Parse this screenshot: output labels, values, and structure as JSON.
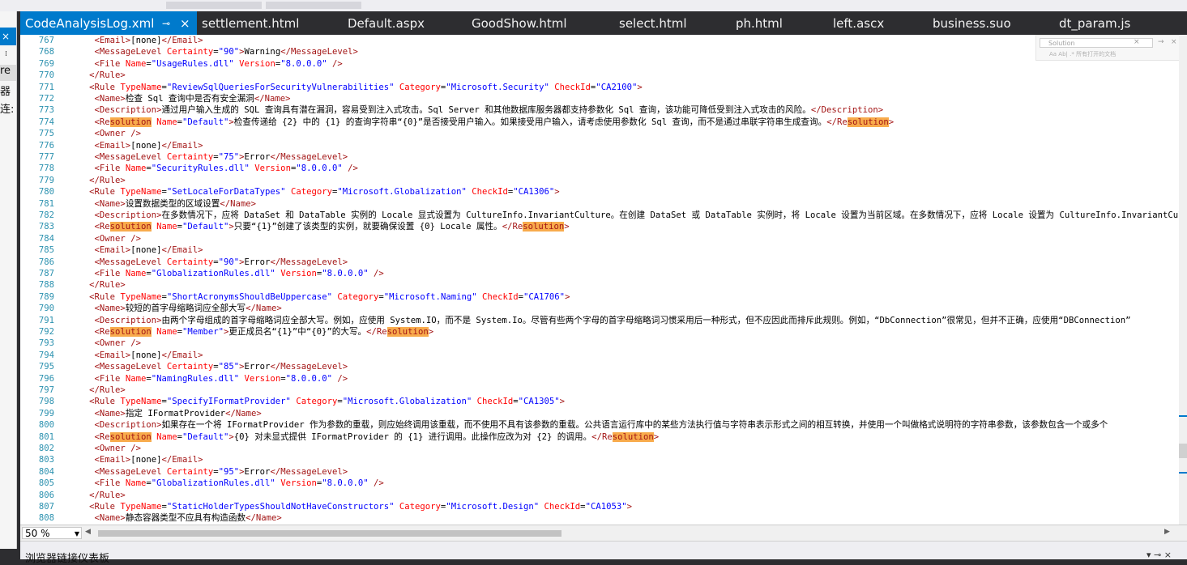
{
  "left_panel": {
    "close_glyph": "×",
    "dots": "⁞",
    "text1": "re",
    "text2": "器",
    "text3": "连:"
  },
  "tabs": [
    {
      "label": "CodeAnalysisLog.xml",
      "active": true,
      "pin": "⊸",
      "close": "×"
    },
    {
      "label": "settlement.html"
    },
    {
      "label": "Default.aspx"
    },
    {
      "label": "GoodShow.html"
    },
    {
      "label": "select.html"
    },
    {
      "label": "ph.html"
    },
    {
      "label": "left.ascx"
    },
    {
      "label": "business.suo"
    },
    {
      "label": "dt_param.js"
    }
  ],
  "search": {
    "placeholder": "Solution",
    "clear_glyph": "×",
    "prev_glyph": "→",
    "close_glyph": "×",
    "options": "Aa  Ab|  .*    所有打开的文档"
  },
  "code_lines": [
    {
      "n": "767",
      "t": "    <Email>[none]</Email>"
    },
    {
      "n": "768",
      "t": "    <MessageLevel Certainty=\"90\">Warning</MessageLevel>"
    },
    {
      "n": "769",
      "t": "    <File Name=\"UsageRules.dll\" Version=\"8.0.0.0\" />"
    },
    {
      "n": "770",
      "t": "   </Rule>"
    },
    {
      "n": "771",
      "t": "   <Rule TypeName=\"ReviewSqlQueriesForSecurityVulnerabilities\" Category=\"Microsoft.Security\" CheckId=\"CA2100\">"
    },
    {
      "n": "772",
      "t": "    <Name>检查 Sql 查询中是否有安全漏洞</Name>"
    },
    {
      "n": "773",
      "t": "    <Description>通过用户输入生成的 SQL 查询具有潜在漏洞，容易受到注入式攻击。Sql Server 和其他数据库服务器都支持参数化 Sql 查询，该功能可降低受到注入式攻击的风险。</Description>"
    },
    {
      "n": "774",
      "t": "    <Resolution Name=\"Default\">检查传递给 {2} 中的 {1} 的查询字符串“{0}”是否接受用户输入。如果接受用户输入，请考虑使用参数化 Sql 查询，而不是通过串联字符串生成查询。</Resolution>"
    },
    {
      "n": "775",
      "t": "    <Owner />"
    },
    {
      "n": "776",
      "t": "    <Email>[none]</Email>"
    },
    {
      "n": "777",
      "t": "    <MessageLevel Certainty=\"75\">Error</MessageLevel>"
    },
    {
      "n": "778",
      "t": "    <File Name=\"SecurityRules.dll\" Version=\"8.0.0.0\" />"
    },
    {
      "n": "779",
      "t": "   </Rule>"
    },
    {
      "n": "780",
      "t": "   <Rule TypeName=\"SetLocaleForDataTypes\" Category=\"Microsoft.Globalization\" CheckId=\"CA1306\">"
    },
    {
      "n": "781",
      "t": "    <Name>设置数据类型的区域设置</Name>"
    },
    {
      "n": "782",
      "t": "    <Description>在多数情况下，应将 DataSet 和 DataTable 实例的 Locale 显式设置为 CultureInfo.InvariantCulture。在创建 DataSet 或 DataTable 实例时，将 Locale 设置为当前区域。在多数情况下，应将 Locale 设置为 CultureInfo.InvariantCulture"
    },
    {
      "n": "783",
      "t": "    <Resolution Name=\"Default\">只要“{1}”创建了该类型的实例，就要确保设置 {0} Locale 属性。</Resolution>"
    },
    {
      "n": "784",
      "t": "    <Owner />"
    },
    {
      "n": "785",
      "t": "    <Email>[none]</Email>"
    },
    {
      "n": "786",
      "t": "    <MessageLevel Certainty=\"90\">Error</MessageLevel>"
    },
    {
      "n": "787",
      "t": "    <File Name=\"GlobalizationRules.dll\" Version=\"8.0.0.0\" />"
    },
    {
      "n": "788",
      "t": "   </Rule>"
    },
    {
      "n": "789",
      "t": "   <Rule TypeName=\"ShortAcronymsShouldBeUppercase\" Category=\"Microsoft.Naming\" CheckId=\"CA1706\">"
    },
    {
      "n": "790",
      "t": "    <Name>较短的首字母缩略词应全部大写</Name>"
    },
    {
      "n": "791",
      "t": "    <Description>由两个字母组成的首字母缩略词应全部大写。例如，应使用 System.IO，而不是 System.Io。尽管有些两个字母的首字母缩略词习惯采用后一种形式，但不应因此而排斥此规则。例如，“DbConnection”很常见，但并不正确，应使用“DBConnection”"
    },
    {
      "n": "792",
      "t": "    <Resolution Name=\"Member\">更正成员名“{1}”中“{0}”的大写。</Resolution>"
    },
    {
      "n": "793",
      "t": "    <Owner />"
    },
    {
      "n": "794",
      "t": "    <Email>[none]</Email>"
    },
    {
      "n": "795",
      "t": "    <MessageLevel Certainty=\"85\">Error</MessageLevel>"
    },
    {
      "n": "796",
      "t": "    <File Name=\"NamingRules.dll\" Version=\"8.0.0.0\" />"
    },
    {
      "n": "797",
      "t": "   </Rule>"
    },
    {
      "n": "798",
      "t": "   <Rule TypeName=\"SpecifyIFormatProvider\" Category=\"Microsoft.Globalization\" CheckId=\"CA1305\">"
    },
    {
      "n": "799",
      "t": "    <Name>指定 IFormatProvider</Name>"
    },
    {
      "n": "800",
      "t": "    <Description>如果存在一个将 IFormatProvider 作为参数的重载，则应始终调用该重载，而不使用不具有该参数的重载。公共语言运行库中的某些方法执行值与字符串表示形式之间的相互转换，并使用一个叫做格式说明符的字符串参数，该参数包含一个或多个"
    },
    {
      "n": "801",
      "t": "    <Resolution Name=\"Default\">{0} 对未显式提供 IFormatProvider 的 {1} 进行调用。此操作应改为对 {2} 的调用。</Resolution>"
    },
    {
      "n": "802",
      "t": "    <Owner />"
    },
    {
      "n": "803",
      "t": "    <Email>[none]</Email>"
    },
    {
      "n": "804",
      "t": "    <MessageLevel Certainty=\"95\">Error</MessageLevel>"
    },
    {
      "n": "805",
      "t": "    <File Name=\"GlobalizationRules.dll\" Version=\"8.0.0.0\" />"
    },
    {
      "n": "806",
      "t": "   </Rule>"
    },
    {
      "n": "807",
      "t": "   <Rule TypeName=\"StaticHolderTypesShouldNotHaveConstructors\" Category=\"Microsoft.Design\" CheckId=\"CA1053\">"
    },
    {
      "n": "808",
      "t": "    <Name>静态容器类型不应具有构造函数</Name>"
    }
  ],
  "highlight_term": "solution",
  "statusbar": {
    "zoom": "50 %",
    "zoom_arrow": "▼",
    "hs_left": "◀",
    "hs_right": "▶"
  },
  "bottom_panel": {
    "title": "浏览器链接仪表板",
    "controls": "▾  ⊸  ×"
  },
  "colors": {
    "accent": "#007acc",
    "line_number": "#2b91af",
    "tag": "#a31515",
    "attr_name": "#ff0000",
    "attr_value": "#0000ff",
    "find_highlight": "#f8ab4c"
  }
}
